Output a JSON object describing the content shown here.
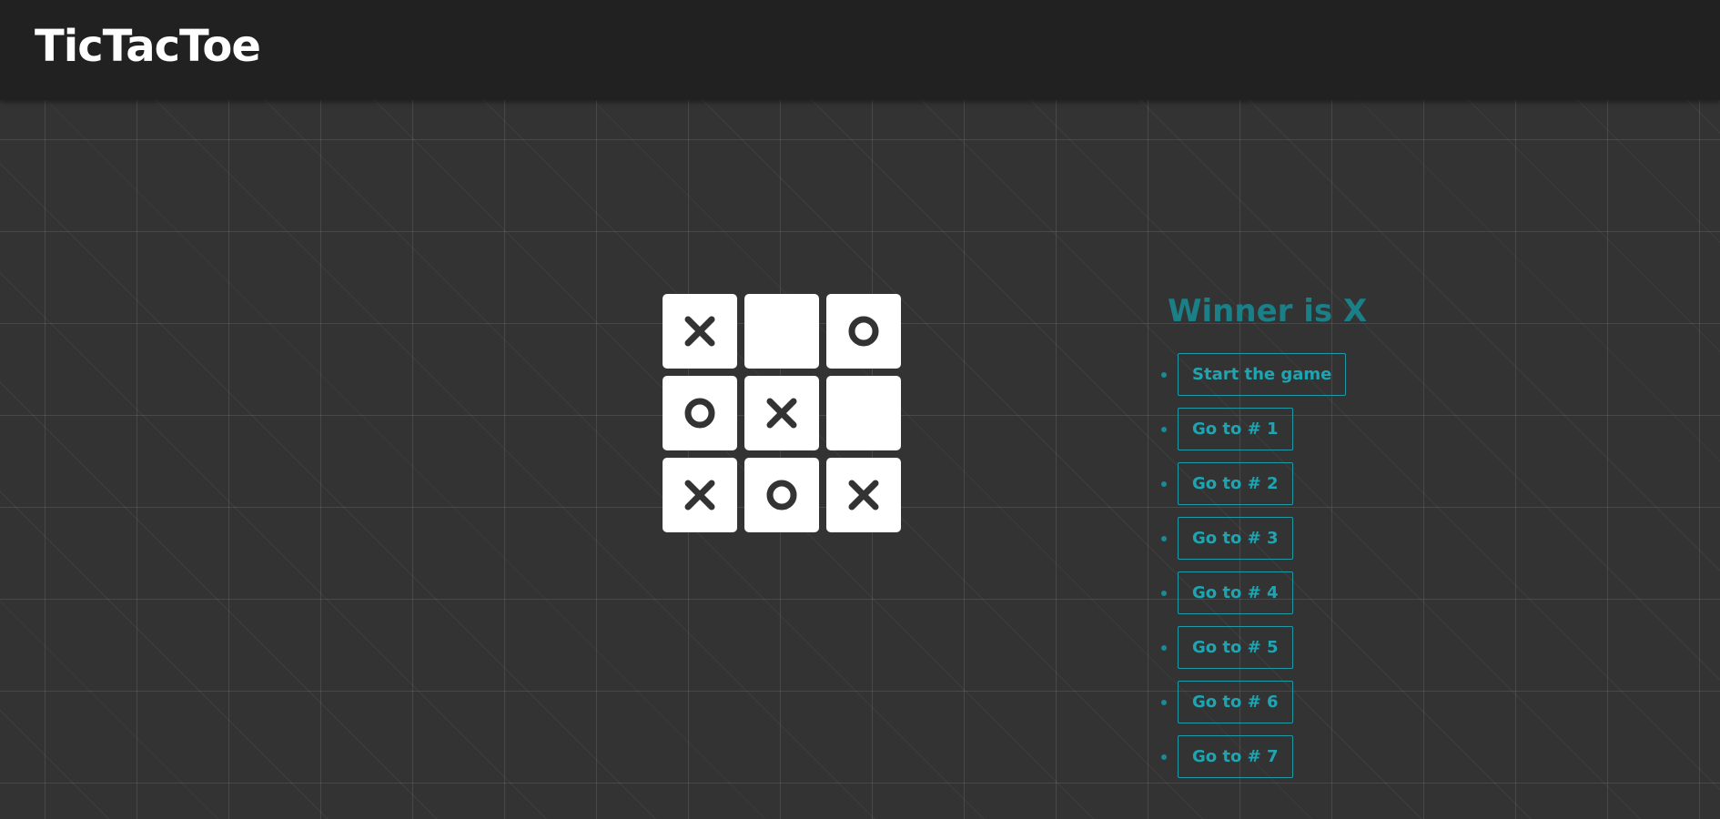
{
  "app": {
    "title": "TicTacToe"
  },
  "board": {
    "cells": [
      "X",
      "",
      "O",
      "O",
      "X",
      "",
      "X",
      "O",
      "X"
    ]
  },
  "status": "Winner is X",
  "moves": [
    {
      "label": "Start the game"
    },
    {
      "label": "Go to # 1"
    },
    {
      "label": "Go to # 2"
    },
    {
      "label": "Go to # 3"
    },
    {
      "label": "Go to # 4"
    },
    {
      "label": "Go to # 5"
    },
    {
      "label": "Go to # 6"
    },
    {
      "label": "Go to # 7"
    }
  ],
  "colors": {
    "header_bg": "#212121",
    "page_bg": "#333333",
    "cell_bg": "#ffffff",
    "mark": "#333333",
    "accent": "#1fa5b2",
    "status": "#1a7f87"
  }
}
